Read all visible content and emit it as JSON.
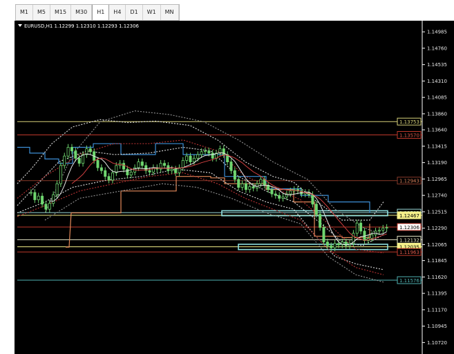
{
  "toolbar": {
    "timeframes": [
      "M1",
      "M5",
      "M15",
      "M30",
      "H1",
      "H4",
      "D1",
      "W1",
      "MN"
    ],
    "active": "H1"
  },
  "chart_data": {
    "type": "candlestick",
    "symbol_header": "EURUSD,H1  1.12299 1.12310 1.12293 1.12306",
    "ylim": [
      1.1061,
      1.151
    ],
    "y_ticks": [
      "1.14985",
      "1.14760",
      "1.14535",
      "1.14310",
      "1.14085",
      "1.13860",
      "1.13640",
      "1.13415",
      "1.13190",
      "1.12965",
      "1.12740",
      "1.12515",
      "1.12290",
      "1.12065",
      "1.11845",
      "1.11620",
      "1.11395",
      "1.11170",
      "1.10945",
      "1.10720"
    ],
    "levels": [
      {
        "price": 1.13753,
        "label": "1.13753",
        "color": "#d8d27a",
        "label_bg": "#000000",
        "label_color": "#d8d27a"
      },
      {
        "price": 1.1357,
        "label": "1.13570",
        "color": "#c0392b",
        "label_bg": "#000000",
        "label_color": "#e05a4a"
      },
      {
        "price": 1.12943,
        "label": "1.12943",
        "color": "#8a3b2b",
        "label_bg": "#000000",
        "label_color": "#d9805a"
      },
      {
        "price": 1.12503,
        "label": "1.12503",
        "color": "#9ad9d9",
        "label_bg": "#000000",
        "label_color": "#9ad9d9"
      },
      {
        "price": 1.12467,
        "label": "1.12467",
        "color": "#f5f08a",
        "label_bg": "#f5f08a",
        "label_color": "#000000"
      },
      {
        "price": 1.12306,
        "label": "1.12306",
        "color": "#c0392b",
        "label_bg": "#ffffff",
        "label_color": "#000000"
      },
      {
        "price": 1.12132,
        "label": "1.12132",
        "color": "#e8e8c8",
        "label_bg": "#000000",
        "label_color": "#e8e8c8"
      },
      {
        "price": 1.12035,
        "label": "1.12035",
        "color": "#f5f08a",
        "label_bg": "#f5f08a",
        "label_color": "#000000"
      },
      {
        "price": 1.11963,
        "label": "1.11963",
        "color": "#c0392b",
        "label_bg": "#000000",
        "label_color": "#e05a4a"
      },
      {
        "price": 1.11576,
        "label": "1.11576",
        "color": "#4fb3b3",
        "label_bg": "#000000",
        "label_color": "#4fb3b3"
      }
    ],
    "candle_closes": [
      1.1278,
      1.1268,
      1.1273,
      1.1262,
      1.1255,
      1.1263,
      1.1275,
      1.129,
      1.1315,
      1.1328,
      1.134,
      1.1335,
      1.1325,
      1.1318,
      1.133,
      1.1338,
      1.1334,
      1.1322,
      1.1312,
      1.1308,
      1.13,
      1.1295,
      1.1305,
      1.1315,
      1.1318,
      1.131,
      1.1302,
      1.1306,
      1.1312,
      1.132,
      1.1315,
      1.1308,
      1.1306,
      1.1312,
      1.131,
      1.1318,
      1.1315,
      1.1308,
      1.131,
      1.1305,
      1.1312,
      1.1322,
      1.1328,
      1.132,
      1.1325,
      1.133,
      1.1334,
      1.1335,
      1.1332,
      1.1325,
      1.1332,
      1.1338,
      1.133,
      1.132,
      1.1308,
      1.1296,
      1.1285,
      1.129,
      1.1282,
      1.1286,
      1.1284,
      1.129,
      1.1296,
      1.1288,
      1.1282,
      1.1276,
      1.1274,
      1.127,
      1.1272,
      1.1276,
      1.128,
      1.1282,
      1.128,
      1.1276,
      1.1278,
      1.1275,
      1.1262,
      1.1248,
      1.123,
      1.121,
      1.1205,
      1.1202,
      1.1208,
      1.1206,
      1.121,
      1.1205,
      1.1208,
      1.1222,
      1.1236,
      1.1225,
      1.1212,
      1.1215,
      1.122,
      1.1225,
      1.1226,
      1.1229,
      1.123
    ],
    "lines": [
      {
        "name": "upper-blue",
        "color": "#3d8fd6",
        "style": "solid",
        "points": [
          [
            0,
            1.134
          ],
          [
            18,
            1.134
          ],
          [
            18,
            1.1332
          ],
          [
            40,
            1.1332
          ],
          [
            40,
            1.1324
          ],
          [
            60,
            1.1324
          ],
          [
            60,
            1.1318
          ],
          [
            80,
            1.1318
          ],
          [
            80,
            1.134
          ],
          [
            110,
            1.134
          ],
          [
            110,
            1.1345
          ],
          [
            150,
            1.1345
          ],
          [
            150,
            1.133
          ],
          [
            200,
            1.133
          ],
          [
            200,
            1.1345
          ],
          [
            240,
            1.1345
          ],
          [
            240,
            1.133
          ],
          [
            300,
            1.133
          ],
          [
            300,
            1.13
          ],
          [
            360,
            1.13
          ],
          [
            360,
            1.1283
          ],
          [
            410,
            1.1283
          ],
          [
            410,
            1.1274
          ],
          [
            450,
            1.1274
          ],
          [
            450,
            1.1265
          ],
          [
            510,
            1.1265
          ],
          [
            510,
            1.125
          ]
        ]
      },
      {
        "name": "lower-orange",
        "color": "#e58a5a",
        "style": "solid",
        "points": [
          [
            70,
            1.1203
          ],
          [
            75,
            1.1203
          ],
          [
            78,
            1.125
          ],
          [
            150,
            1.125
          ],
          [
            150,
            1.128
          ],
          [
            230,
            1.128
          ],
          [
            230,
            1.13
          ],
          [
            280,
            1.13
          ],
          [
            280,
            1.1298
          ],
          [
            300,
            1.1298
          ],
          [
            300,
            1.129
          ],
          [
            360,
            1.129
          ],
          [
            360,
            1.1282
          ],
          [
            400,
            1.1282
          ],
          [
            400,
            1.1265
          ],
          [
            430,
            1.1265
          ],
          [
            430,
            1.1218
          ],
          [
            470,
            1.1218
          ],
          [
            470,
            1.1216
          ],
          [
            510,
            1.1216
          ],
          [
            510,
            1.1235
          ]
        ]
      },
      {
        "name": "dashed-white-1",
        "color": "#cfcfcf",
        "style": "dashed",
        "points": [
          [
            0,
            1.129
          ],
          [
            20,
            1.131
          ],
          [
            50,
            1.1345
          ],
          [
            80,
            1.1368
          ],
          [
            120,
            1.1378
          ],
          [
            160,
            1.1374
          ],
          [
            200,
            1.1376
          ],
          [
            250,
            1.137
          ],
          [
            290,
            1.135
          ],
          [
            330,
            1.132
          ],
          [
            370,
            1.13
          ],
          [
            400,
            1.1292
          ],
          [
            430,
            1.1268
          ],
          [
            470,
            1.124
          ],
          [
            510,
            1.124
          ],
          [
            530,
            1.1265
          ]
        ]
      },
      {
        "name": "dashed-white-2",
        "color": "#cfcfcf",
        "style": "dashed",
        "points": [
          [
            0,
            1.126
          ],
          [
            30,
            1.129
          ],
          [
            60,
            1.132
          ],
          [
            100,
            1.1335
          ],
          [
            140,
            1.133
          ],
          [
            190,
            1.1332
          ],
          [
            240,
            1.134
          ],
          [
            280,
            1.1335
          ],
          [
            320,
            1.13
          ],
          [
            360,
            1.128
          ],
          [
            400,
            1.1265
          ],
          [
            440,
            1.1235
          ],
          [
            470,
            1.121
          ],
          [
            500,
            1.1205
          ],
          [
            530,
            1.122
          ]
        ]
      },
      {
        "name": "dashed-white-3",
        "color": "#cfcfcf",
        "style": "dashed",
        "points": [
          [
            0,
            1.125
          ],
          [
            40,
            1.1265
          ],
          [
            80,
            1.1285
          ],
          [
            130,
            1.1295
          ],
          [
            180,
            1.13
          ],
          [
            230,
            1.131
          ],
          [
            280,
            1.1305
          ],
          [
            320,
            1.128
          ],
          [
            360,
            1.1265
          ],
          [
            400,
            1.1255
          ],
          [
            430,
            1.122
          ],
          [
            460,
            1.119
          ],
          [
            490,
            1.118
          ],
          [
            530,
            1.1172
          ]
        ]
      },
      {
        "name": "dashed-red-1",
        "color": "#b03030",
        "style": "dashed",
        "points": [
          [
            0,
            1.127
          ],
          [
            40,
            1.13
          ],
          [
            90,
            1.133
          ],
          [
            140,
            1.1345
          ],
          [
            190,
            1.1345
          ],
          [
            240,
            1.135
          ],
          [
            290,
            1.1335
          ],
          [
            330,
            1.13
          ],
          [
            370,
            1.1285
          ],
          [
            410,
            1.1268
          ],
          [
            450,
            1.1235
          ],
          [
            490,
            1.12
          ],
          [
            530,
            1.1195
          ]
        ]
      },
      {
        "name": "dashed-red-2",
        "color": "#b03030",
        "style": "dashed",
        "points": [
          [
            0,
            1.1245
          ],
          [
            40,
            1.126
          ],
          [
            90,
            1.128
          ],
          [
            140,
            1.129
          ],
          [
            190,
            1.13
          ],
          [
            240,
            1.1305
          ],
          [
            290,
            1.129
          ],
          [
            330,
            1.127
          ],
          [
            370,
            1.1255
          ],
          [
            410,
            1.124
          ],
          [
            450,
            1.12
          ],
          [
            490,
            1.1175
          ],
          [
            530,
            1.1165
          ]
        ]
      },
      {
        "name": "dashed-gray-outer",
        "color": "#8a8a8a",
        "style": "dashed",
        "points": [
          [
            40,
            1.125
          ],
          [
            80,
            1.133
          ],
          [
            120,
            1.1375
          ],
          [
            170,
            1.139
          ],
          [
            220,
            1.1385
          ],
          [
            270,
            1.1375
          ],
          [
            320,
            1.135
          ],
          [
            370,
            1.132
          ],
          [
            420,
            1.1296
          ],
          [
            460,
            1.1255
          ],
          [
            500,
            1.123
          ],
          [
            530,
            1.122
          ]
        ]
      },
      {
        "name": "dashed-gray-lower",
        "color": "#8a8a8a",
        "style": "dashed",
        "points": [
          [
            40,
            1.124
          ],
          [
            90,
            1.127
          ],
          [
            150,
            1.128
          ],
          [
            210,
            1.129
          ],
          [
            260,
            1.1285
          ],
          [
            310,
            1.127
          ],
          [
            360,
            1.125
          ],
          [
            410,
            1.1235
          ],
          [
            450,
            1.119
          ],
          [
            490,
            1.1165
          ],
          [
            530,
            1.1155
          ]
        ]
      }
    ],
    "rectangles": [
      {
        "x0": 296,
        "x1": 536,
        "p_high": 1.1251,
        "p_low": 1.1248,
        "color": "#8fe0e0"
      },
      {
        "x0": 320,
        "x1": 536,
        "p_high": 1.1205,
        "p_low": 1.12015,
        "color": "#8fe0e0"
      }
    ],
    "moving_averages": [
      {
        "name": "ma-white",
        "color": "#e8e8e8",
        "period": 6
      },
      {
        "name": "ma-red",
        "color": "#d04040",
        "period": 12
      }
    ]
  }
}
